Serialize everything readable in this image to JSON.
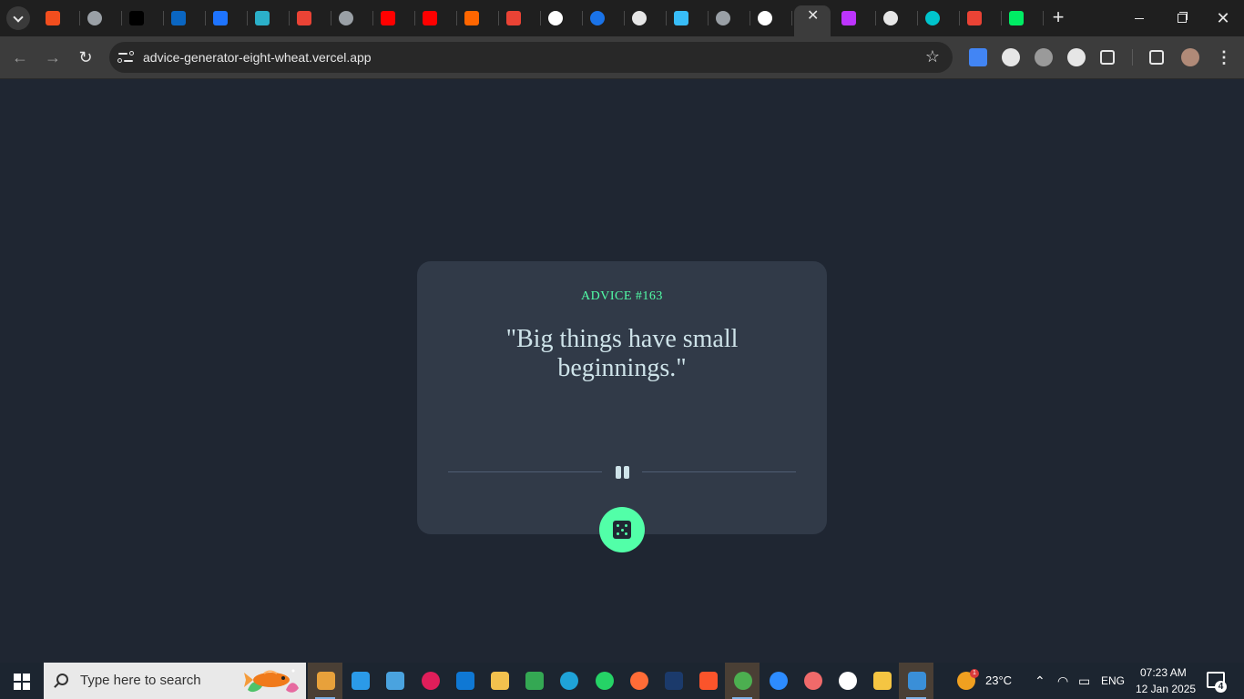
{
  "browser": {
    "tabs": [
      {
        "icon": "figma-icon",
        "color": "#f24e1e"
      },
      {
        "icon": "globe-icon",
        "color": "#9aa0a6"
      },
      {
        "icon": "upwork-icon",
        "color": "#000000"
      },
      {
        "icon": "linkedin-icon",
        "color": "#0a66c2"
      },
      {
        "icon": "jira-icon",
        "color": "#1e74ff"
      },
      {
        "icon": "vitest-icon",
        "color": "#2bb0c9"
      },
      {
        "icon": "gmail-icon",
        "color": "#ea4335"
      },
      {
        "icon": "globe-icon",
        "color": "#9aa0a6"
      },
      {
        "icon": "youtube-icon",
        "color": "#ff0000"
      },
      {
        "icon": "youtube-icon",
        "color": "#ff0000"
      },
      {
        "icon": "hacker-news-icon",
        "color": "#ff6600"
      },
      {
        "icon": "gmail-icon",
        "color": "#ea4335"
      },
      {
        "icon": "info-icon",
        "color": "#ffffff"
      },
      {
        "icon": "loop-icon",
        "color": "#1a73e8"
      },
      {
        "icon": "openai-icon",
        "color": "#e6e6e6"
      },
      {
        "icon": "tailwind-icon",
        "color": "#38bdf8"
      },
      {
        "icon": "globe-icon",
        "color": "#9aa0a6"
      },
      {
        "icon": "github-icon",
        "color": "#ffffff"
      },
      {
        "icon": "close-icon",
        "color": "#e6e6e6",
        "active": true
      },
      {
        "icon": "vite-icon",
        "color": "#bd34fe"
      },
      {
        "icon": "globe-icon",
        "color": "#e6e6e6"
      },
      {
        "icon": "canva-icon",
        "color": "#00c4cc"
      },
      {
        "icon": "gmail-icon",
        "color": "#ea4335"
      },
      {
        "icon": "mongodb-icon",
        "color": "#00ed64"
      }
    ],
    "new_tab": "+",
    "url": "advice-generator-eight-wheat.vercel.app",
    "extensions": [
      {
        "icon": "google-docs-icon",
        "color": "#4285f4"
      },
      {
        "icon": "ghost-icon",
        "color": "#e6e6e6"
      },
      {
        "icon": "ink-icon",
        "color": "#9a9a9a"
      },
      {
        "icon": "grammarly-icon",
        "color": "#e6e6e6"
      },
      {
        "icon": "puzzle-icon",
        "color": "#e6e6e6"
      },
      {
        "icon": "download-icon",
        "color": "#e6e6e6"
      },
      {
        "icon": "avatar",
        "color": "#b08a78"
      }
    ]
  },
  "advice": {
    "id_label": "ADVICE #163",
    "quote": "\"Big things have small beginnings.\"",
    "accent_color": "#52ffa8",
    "card_color": "#313a48",
    "background_color": "#1f2632"
  },
  "taskbar": {
    "search_placeholder": "Type here to search",
    "apps": [
      {
        "icon": "copilot-icon",
        "color": "#e8a13b",
        "active": true
      },
      {
        "icon": "vscode-icon",
        "color": "#2b9ae8"
      },
      {
        "icon": "store-icon",
        "color": "#4aa3df"
      },
      {
        "icon": "slack-icon",
        "color": "#e01e5a"
      },
      {
        "icon": "outlook-icon",
        "color": "#0f78d4"
      },
      {
        "icon": "git-icon",
        "color": "#f2c14e"
      },
      {
        "icon": "meet-icon",
        "color": "#34a853"
      },
      {
        "icon": "edge-icon",
        "color": "#1fa3d8"
      },
      {
        "icon": "whatsapp-icon",
        "color": "#25d366"
      },
      {
        "icon": "postman-icon",
        "color": "#ff6c37"
      },
      {
        "icon": "jmeter-icon",
        "color": "#1b3a6b"
      },
      {
        "icon": "brave-icon",
        "color": "#fb542b"
      },
      {
        "icon": "chrome-icon",
        "color": "#4caf50",
        "active": true
      },
      {
        "icon": "zoom-icon",
        "color": "#2d8cff"
      },
      {
        "icon": "asana-icon",
        "color": "#f06a6a"
      },
      {
        "icon": "hub-icon",
        "color": "#ffffff"
      },
      {
        "icon": "file-explorer-icon",
        "color": "#f5c542"
      },
      {
        "icon": "paint-icon",
        "color": "#3a8fd8",
        "active": true
      }
    ],
    "weather": {
      "temp": "23°C",
      "badge": "1"
    },
    "language": "ENG",
    "time": "07:23 AM",
    "date": "12 Jan 2025",
    "notifications": "4"
  }
}
